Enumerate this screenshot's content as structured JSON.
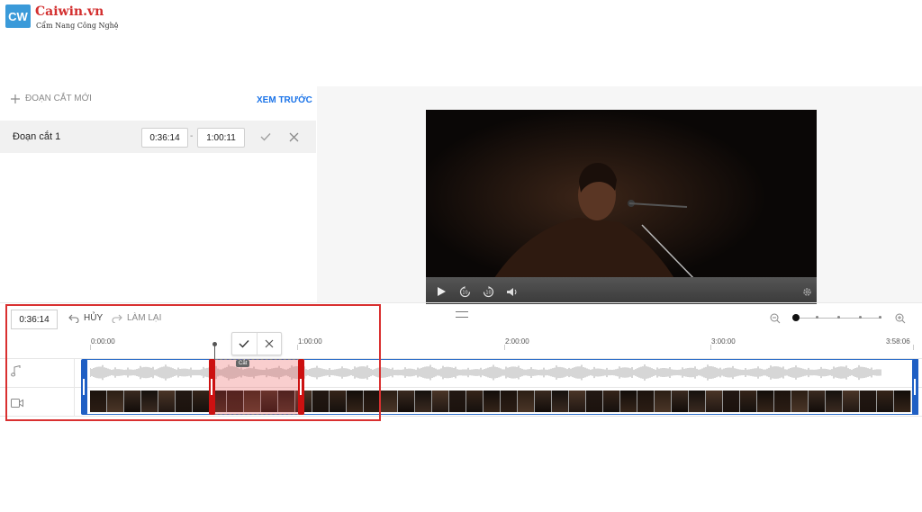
{
  "watermark": {
    "logo_text": "CW",
    "site_name": "Caiwin.vn",
    "tagline": "Cẩm Nang Công Nghệ"
  },
  "cut_panel": {
    "new_cut_label": "ĐOẠN CẮT MỚI",
    "preview_label": "XEM TRƯỚC",
    "segments": [
      {
        "label": "Đoạn cắt 1",
        "start": "0:36:14",
        "separator": "-",
        "end": "1:00:11"
      }
    ]
  },
  "editor": {
    "current_time": "0:36:14",
    "undo_label": "HỦY",
    "redo_label": "LÀM LẠI",
    "ruler": [
      "0:00:00",
      "1:00:00",
      "2:00:00",
      "3:00:00",
      "3:58:06"
    ],
    "cut_tooltip": "Cắt",
    "selection": {
      "start": "0:36:14",
      "end": "1:00:11"
    },
    "zoom_level": 0.0
  },
  "colors": {
    "accent": "#1a73e8",
    "track_border": "#2f6fc9",
    "selection": "#cc1111",
    "highlight_box": "#d93030",
    "logo_blue": "#3a9ad9",
    "logo_red": "#d32f2f"
  },
  "icons": {
    "new_cut": "plus-icon",
    "confirm": "check-icon",
    "delete": "close-icon",
    "play": "play-icon",
    "rewind": "rewind-10-icon",
    "forward": "forward-10-icon",
    "volume": "volume-icon",
    "settings": "gear-icon",
    "undo": "undo-icon",
    "redo": "redo-icon",
    "zoom_out": "zoom-out-icon",
    "zoom_in": "zoom-in-icon",
    "audio_track": "music-note-icon",
    "video_track": "video-camera-icon"
  }
}
